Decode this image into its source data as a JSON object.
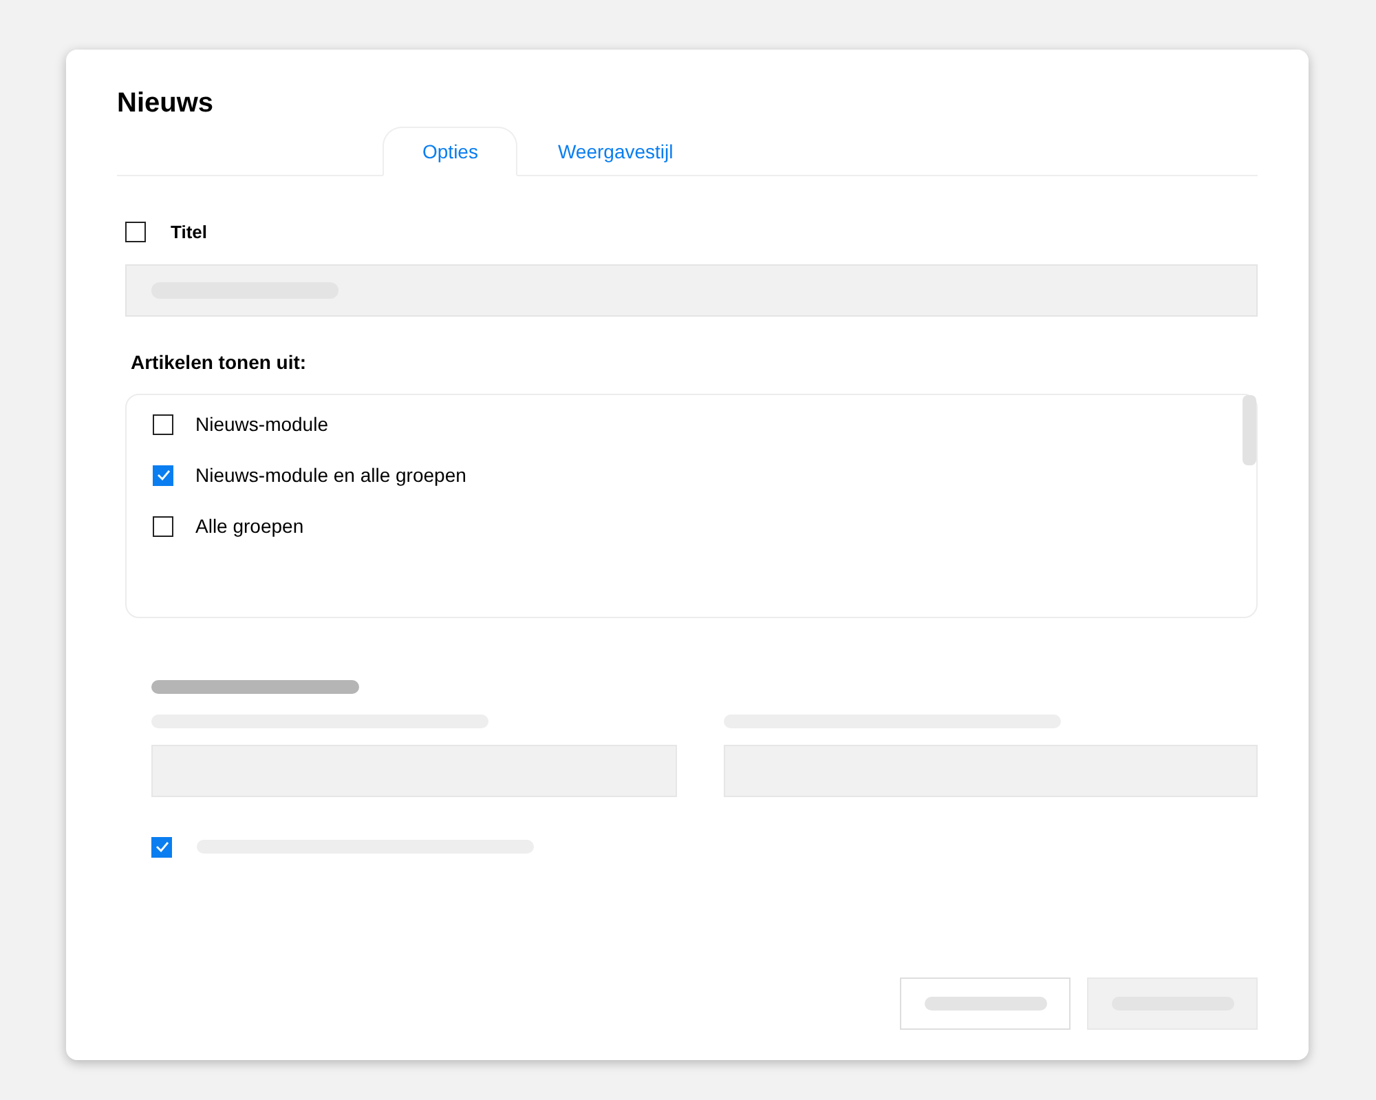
{
  "dialog": {
    "title": "Nieuws"
  },
  "tabs": [
    {
      "label": "Opties",
      "selected": true
    },
    {
      "label": "Weergavestijl",
      "selected": false
    }
  ],
  "title_option": {
    "label": "Titel",
    "checked": false
  },
  "source": {
    "label": "Artikelen tonen uit:",
    "options": [
      {
        "label": "Nieuws-module",
        "checked": false
      },
      {
        "label": "Nieuws-module en alle groepen",
        "checked": true
      },
      {
        "label": "Alle groepen",
        "checked": false
      }
    ]
  },
  "lower_option": {
    "checked": true
  }
}
